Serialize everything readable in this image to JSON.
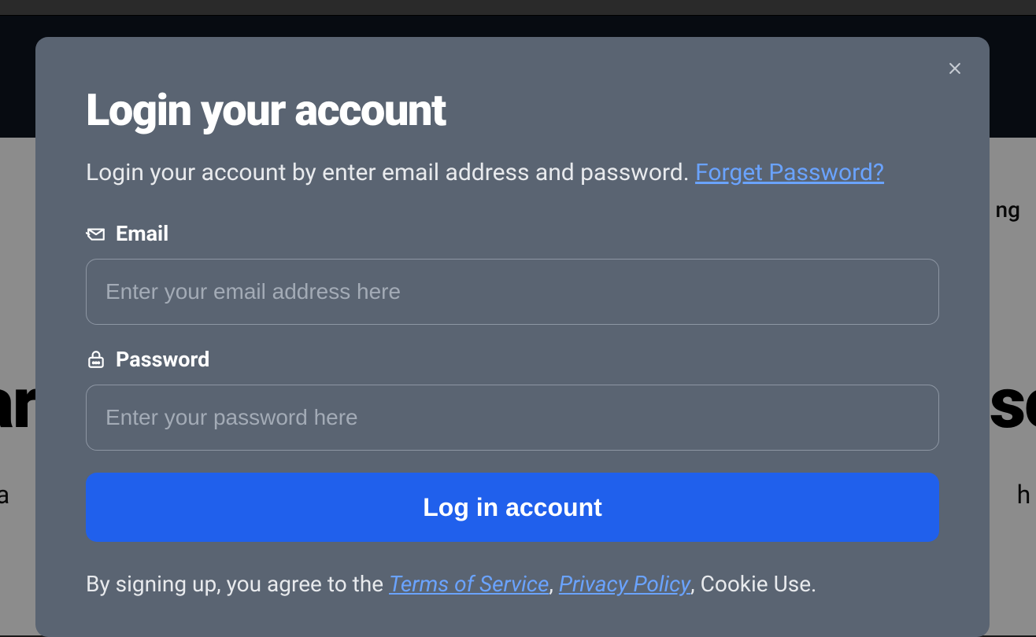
{
  "background": {
    "nav_rhs_fragment": "ng",
    "hero_left_fragment": "ar",
    "hero_right_fragment": "sc",
    "sub_left_fragment": "e a",
    "sub_right_fragment": "h pr"
  },
  "modal": {
    "title": "Login your account",
    "subtitle_text": "Login your account by enter email address and password. ",
    "forgot_link": "Forget Password?",
    "email": {
      "label": "Email",
      "placeholder": "Enter your email address here",
      "value": ""
    },
    "password": {
      "label": "Password",
      "placeholder": "Enter your password here",
      "value": ""
    },
    "submit_label": "Log in account",
    "footer": {
      "prefix": "By signing up, you agree to the ",
      "tos": "Terms of Service",
      "sep1": ", ",
      "privacy": "Privacy Policy",
      "suffix": ", Cookie Use."
    }
  }
}
